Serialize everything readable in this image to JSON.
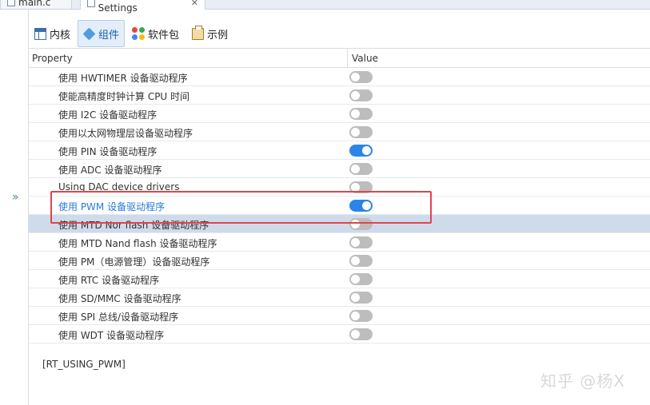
{
  "editor_tabs": [
    {
      "label": "main.c",
      "icon": "c-file-icon"
    },
    {
      "label": "RT-Thread Settings",
      "icon": "settings-file-icon",
      "close": "✕"
    }
  ],
  "section_tabs": [
    {
      "label": "内核",
      "icon": "kernel-icon"
    },
    {
      "label": "组件",
      "icon": "component-icon",
      "active": true
    },
    {
      "label": "软件包",
      "icon": "package-icon"
    },
    {
      "label": "示例",
      "icon": "example-icon"
    }
  ],
  "gutter": {
    "expand_glyph": "»"
  },
  "table": {
    "headers": {
      "property": "Property",
      "value": "Value"
    },
    "rows": [
      {
        "label": "使用 HWTIMER 设备驱动程序",
        "on": false
      },
      {
        "label": "使能高精度时钟计算 CPU 时间",
        "on": false
      },
      {
        "label": "使用 I2C 设备驱动程序",
        "on": false
      },
      {
        "label": "使用以太网物理层设备驱动程序",
        "on": false
      },
      {
        "label": "使用 PIN 设备驱动程序",
        "on": true
      },
      {
        "label": "使用 ADC 设备驱动程序",
        "on": false
      },
      {
        "label": "Using DAC device drivers",
        "on": false
      },
      {
        "label": "使用 PWM 设备驱动程序",
        "on": true
      },
      {
        "label": "使用 MTD Nor flash 设备驱动程序",
        "on": false
      },
      {
        "label": "使用 MTD Nand flash 设备驱动程序",
        "on": false
      },
      {
        "label": "使用 PM（电源管理）设备驱动程序",
        "on": false
      },
      {
        "label": "使用 RTC 设备驱动程序",
        "on": false
      },
      {
        "label": "使用 SD/MMC 设备驱动程序",
        "on": false
      },
      {
        "label": "使用 SPI 总线/设备驱动程序",
        "on": false
      },
      {
        "label": "使用 WDT 设备驱动程序",
        "on": false
      }
    ],
    "highlighted_row": "使用 PWM 设备驱动程序",
    "selected_row": "使用 MTD Nor flash 设备驱动程序"
  },
  "macro_label": "[RT_USING_PWM]",
  "watermark": "知乎 @杨X",
  "colors": {
    "toggle_on": "#2a85e8",
    "toggle_off": "#bdbdbd",
    "highlight_box": "#e0454a",
    "selected_row": "#cfdbeb"
  }
}
